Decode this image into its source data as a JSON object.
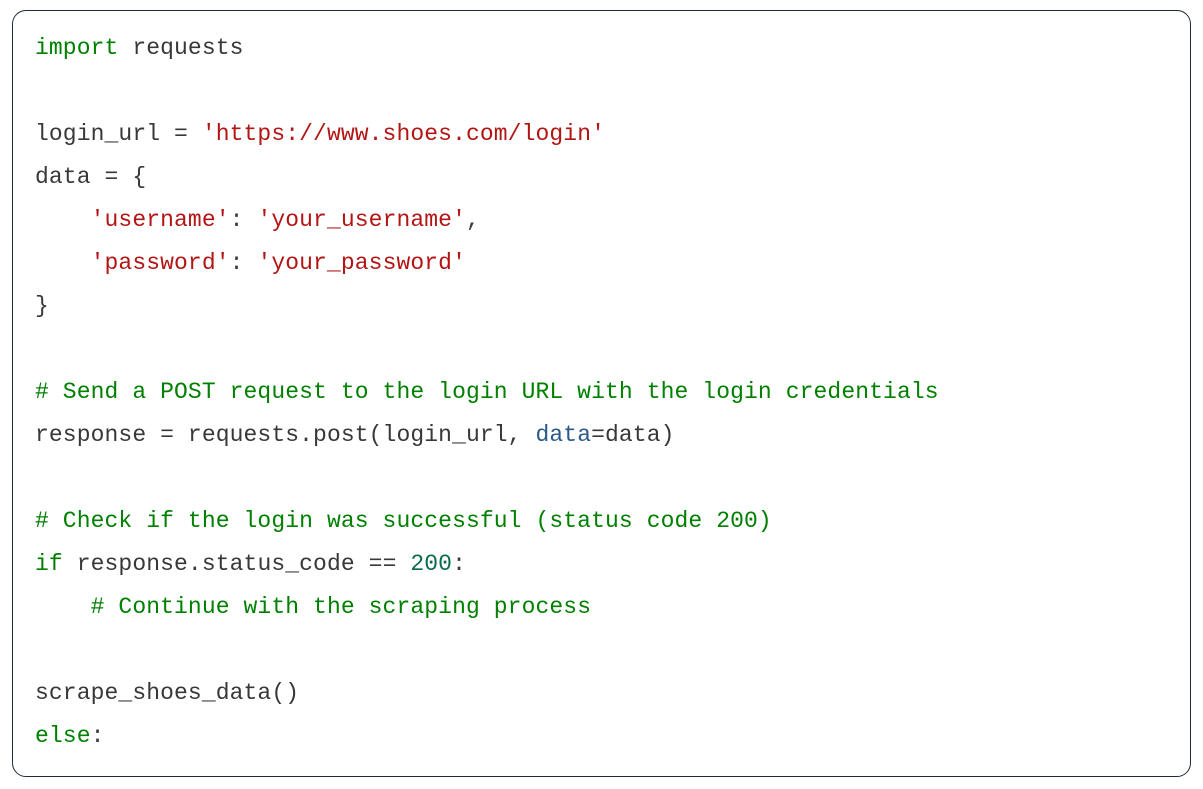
{
  "code": {
    "lines": [
      {
        "indent": 0,
        "segments": [
          {
            "cls": "tok-kw",
            "text": "import"
          },
          {
            "cls": "tok-plain",
            "text": " requests"
          }
        ]
      },
      {
        "indent": 0,
        "segments": []
      },
      {
        "indent": 0,
        "segments": [
          {
            "cls": "tok-plain",
            "text": "login_url = "
          },
          {
            "cls": "tok-str",
            "text": "'https://www.shoes.com/login'"
          }
        ]
      },
      {
        "indent": 0,
        "segments": [
          {
            "cls": "tok-plain",
            "text": "data = {"
          }
        ]
      },
      {
        "indent": 1,
        "segments": [
          {
            "cls": "tok-str",
            "text": "'username'"
          },
          {
            "cls": "tok-plain",
            "text": ": "
          },
          {
            "cls": "tok-str",
            "text": "'your_username'"
          },
          {
            "cls": "tok-plain",
            "text": ","
          }
        ]
      },
      {
        "indent": 1,
        "segments": [
          {
            "cls": "tok-str",
            "text": "'password'"
          },
          {
            "cls": "tok-plain",
            "text": ": "
          },
          {
            "cls": "tok-str",
            "text": "'your_password'"
          }
        ]
      },
      {
        "indent": 0,
        "segments": [
          {
            "cls": "tok-plain",
            "text": "}"
          }
        ]
      },
      {
        "indent": 0,
        "segments": []
      },
      {
        "indent": 0,
        "segments": [
          {
            "cls": "tok-comment",
            "text": "# Send a POST request to the login URL with the login credentials"
          }
        ]
      },
      {
        "indent": 0,
        "segments": [
          {
            "cls": "tok-plain",
            "text": "response = requests.post(login_url, "
          },
          {
            "cls": "tok-kwarg",
            "text": "data"
          },
          {
            "cls": "tok-plain",
            "text": "=data)"
          }
        ]
      },
      {
        "indent": 0,
        "segments": []
      },
      {
        "indent": 0,
        "segments": [
          {
            "cls": "tok-comment",
            "text": "# Check if the login was successful (status code 200)"
          }
        ]
      },
      {
        "indent": 0,
        "segments": [
          {
            "cls": "tok-kw",
            "text": "if"
          },
          {
            "cls": "tok-plain",
            "text": " response.status_code == "
          },
          {
            "cls": "tok-num",
            "text": "200"
          },
          {
            "cls": "tok-plain",
            "text": ":"
          }
        ]
      },
      {
        "indent": 1,
        "segments": [
          {
            "cls": "tok-comment",
            "text": "# Continue with the scraping process"
          }
        ]
      },
      {
        "indent": 0,
        "segments": []
      },
      {
        "indent": 0,
        "segments": [
          {
            "cls": "tok-plain",
            "text": "scrape_shoes_data()"
          }
        ]
      },
      {
        "indent": 0,
        "segments": [
          {
            "cls": "tok-kw",
            "text": "else"
          },
          {
            "cls": "tok-plain",
            "text": ":"
          }
        ]
      }
    ],
    "indent_unit": "    "
  }
}
